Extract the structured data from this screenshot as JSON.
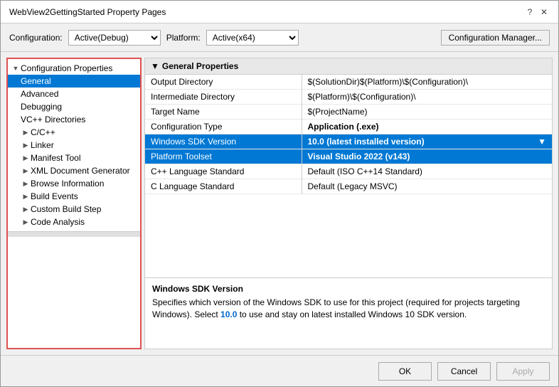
{
  "dialog": {
    "title": "WebView2GettingStarted Property Pages",
    "title_controls": {
      "help": "?",
      "close": "✕"
    }
  },
  "toolbar": {
    "configuration_label": "Configuration:",
    "configuration_value": "Active(Debug)",
    "platform_label": "Platform:",
    "platform_value": "Active(x64)",
    "config_manager_label": "Configuration Manager..."
  },
  "left_panel": {
    "root_item": "Configuration Properties",
    "items": [
      {
        "id": "general",
        "label": "General",
        "indent": 2,
        "selected": true,
        "expandable": false
      },
      {
        "id": "advanced",
        "label": "Advanced",
        "indent": 2,
        "expandable": false
      },
      {
        "id": "debugging",
        "label": "Debugging",
        "indent": 2,
        "expandable": false
      },
      {
        "id": "vcpp-directories",
        "label": "VC++ Directories",
        "indent": 2,
        "expandable": false
      },
      {
        "id": "cpp",
        "label": "C/C++",
        "indent": 2,
        "expandable": true
      },
      {
        "id": "linker",
        "label": "Linker",
        "indent": 2,
        "expandable": true
      },
      {
        "id": "manifest-tool",
        "label": "Manifest Tool",
        "indent": 2,
        "expandable": true
      },
      {
        "id": "xml-doc-gen",
        "label": "XML Document Generator",
        "indent": 2,
        "expandable": true
      },
      {
        "id": "browse-info",
        "label": "Browse Information",
        "indent": 2,
        "expandable": true
      },
      {
        "id": "build-events",
        "label": "Build Events",
        "indent": 2,
        "expandable": true
      },
      {
        "id": "custom-build-step",
        "label": "Custom Build Step",
        "indent": 2,
        "expandable": true
      },
      {
        "id": "code-analysis",
        "label": "Code Analysis",
        "indent": 2,
        "expandable": true
      }
    ]
  },
  "right_panel": {
    "section_title": "General Properties",
    "properties": [
      {
        "id": "output-dir",
        "name": "Output Directory",
        "value": "$(SolutionDir)$(Platform)\\$(Configuration)\\",
        "bold": false,
        "selected": false
      },
      {
        "id": "intermediate-dir",
        "name": "Intermediate Directory",
        "value": "$(Platform)\\$(Configuration)\\",
        "bold": false,
        "selected": false
      },
      {
        "id": "target-name",
        "name": "Target Name",
        "value": "$(ProjectName)",
        "bold": false,
        "selected": false
      },
      {
        "id": "config-type",
        "name": "Configuration Type",
        "value": "Application (.exe)",
        "bold": true,
        "selected": false
      },
      {
        "id": "windows-sdk",
        "name": "Windows SDK Version",
        "value": "10.0 (latest installed version)",
        "bold": true,
        "selected": true,
        "has_dropdown": true
      },
      {
        "id": "platform-toolset",
        "name": "Platform Toolset",
        "value": "Visual Studio 2022 (v143)",
        "bold": true,
        "selected": true,
        "has_dropdown": false
      },
      {
        "id": "cpp-lang-std",
        "name": "C++ Language Standard",
        "value": "Default (ISO C++14 Standard)",
        "bold": false,
        "selected": false
      },
      {
        "id": "c-lang-std",
        "name": "C Language Standard",
        "value": "Default (Legacy MSVC)",
        "bold": false,
        "selected": false
      }
    ]
  },
  "info_panel": {
    "title": "Windows SDK Version",
    "text_parts": [
      "Specifies which version of the Windows SDK to use for this project (required for projects targeting Windows). Select ",
      "10.0",
      " to use and stay on latest installed Windows 10 SDK version."
    ]
  },
  "bottom_bar": {
    "ok_label": "OK",
    "cancel_label": "Cancel",
    "apply_label": "Apply"
  }
}
